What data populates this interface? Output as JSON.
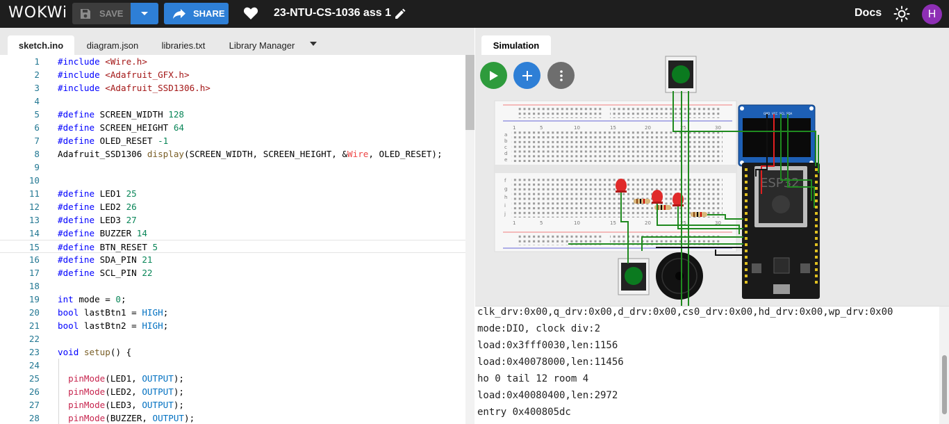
{
  "topbar": {
    "logo": "WOKWi",
    "save_label": "SAVE",
    "share_label": "SHARE",
    "project_title": "23-NTU-CS-1036 ass 1",
    "docs_label": "Docs",
    "avatar_initial": "H",
    "icons": [
      "save-icon",
      "chevron-down-icon",
      "share-icon",
      "heart-icon",
      "pencil-icon",
      "sun-icon"
    ]
  },
  "editor": {
    "tabs": [
      {
        "label": "sketch.ino",
        "active": true
      },
      {
        "label": "diagram.json"
      },
      {
        "label": "libraries.txt"
      },
      {
        "label": "Library Manager"
      }
    ],
    "line_numbers": [
      "1",
      "2",
      "3",
      "4",
      "5",
      "6",
      "7",
      "8",
      "9",
      "10",
      "11",
      "12",
      "13",
      "14",
      "15",
      "16",
      "17",
      "18",
      "19",
      "20",
      "21",
      "22",
      "23",
      "24",
      "25",
      "26",
      "27",
      "28"
    ],
    "code": [
      "#include <Wire.h>",
      "#include <Adafruit_GFX.h>",
      "#include <Adafruit_SSD1306.h>",
      "",
      "#define SCREEN_WIDTH 128",
      "#define SCREEN_HEIGHT 64",
      "#define OLED_RESET -1",
      "Adafruit_SSD1306 display(SCREEN_WIDTH, SCREEN_HEIGHT, &Wire, OLED_RESET);",
      "",
      "",
      "#define LED1 25",
      "#define LED2 26",
      "#define LED3 27",
      "#define BUZZER 14",
      "#define BTN_RESET 5",
      "#define SDA_PIN 21",
      "#define SCL_PIN 22",
      "",
      "int mode = 0;",
      "bool lastBtn1 = HIGH;",
      "bool lastBtn2 = HIGH;",
      "",
      "void setup() {",
      "",
      "  pinMode(LED1, OUTPUT);",
      "  pinMode(LED2, OUTPUT);",
      "  pinMode(LED3, OUTPUT);",
      "  pinMode(BUZZER, OUTPUT);"
    ]
  },
  "simulation": {
    "tab_label": "Simulation",
    "esp_label": "ESP32",
    "breadboard_col_labels": [
      "1",
      "5",
      "10",
      "15",
      "20",
      "25",
      "30"
    ],
    "breadboard_row_labels_top": [
      "a",
      "b",
      "c",
      "d",
      "e"
    ],
    "breadboard_row_labels_bottom": [
      "f",
      "g",
      "h",
      "i",
      "j"
    ],
    "oled_pins": [
      "GND",
      "VCC",
      "SCL",
      "SDA"
    ],
    "serial_output": [
      "clk_drv:0x00,q_drv:0x00,d_drv:0x00,cs0_drv:0x00,hd_drv:0x00,wp_drv:0x00",
      "mode:DIO, clock div:2",
      "load:0x3fff0030,len:1156",
      "load:0x40078000,len:11456",
      "ho 0 tail 12 room 4",
      "load:0x40080400,len:2972",
      "entry 0x400805dc"
    ],
    "colors": {
      "play": "#2e9b3c",
      "add": "#2e7fd6",
      "menu": "#6e6e6e",
      "wire_green": "#1f8a1f",
      "wire_red": "#e02020",
      "pushbutton": "#0b7a1f",
      "led": "#e02a2a"
    }
  }
}
